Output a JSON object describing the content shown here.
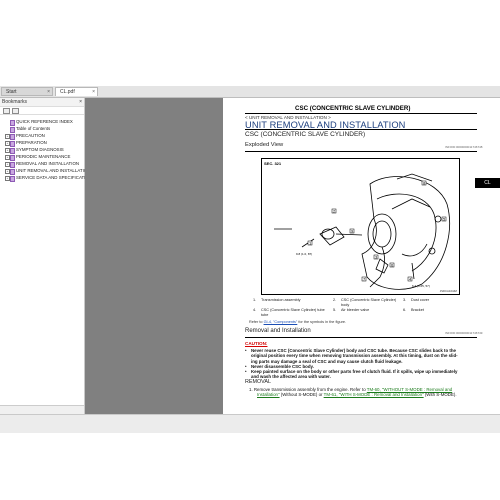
{
  "tabs": [
    {
      "label": "Start",
      "close": "×"
    },
    {
      "label": "CL.pdf",
      "close": "×"
    }
  ],
  "sidebar": {
    "title": "Bookmarks",
    "close": "×",
    "items": [
      {
        "label": "QUICK REFERENCE INDEX",
        "expander": ""
      },
      {
        "label": "Table of Contents",
        "expander": ""
      },
      {
        "label": "PRECAUTION",
        "expander": "+"
      },
      {
        "label": "PREPARATION",
        "expander": "+"
      },
      {
        "label": "SYMPTOM DIAGNOSIS",
        "expander": "+"
      },
      {
        "label": "PERIODIC MAINTENANCE",
        "expander": "+"
      },
      {
        "label": "REMOVAL AND INSTALLATION",
        "expander": "+"
      },
      {
        "label": "UNIT REMOVAL AND INSTALLATIO",
        "expander": "+"
      },
      {
        "label": "SERVICE DATA AND SPECIFICATI",
        "expander": "+"
      }
    ]
  },
  "document": {
    "title": "CSC (CONCENTRIC SLAVE CYLINDER)",
    "breadcrumb": "< UNIT REMOVAL AND INSTALLATION >",
    "section_title": "UNIT REMOVAL AND INSTALLATION",
    "subsection_title": "CSC (CONCENTRIC SLAVE CYLINDER)",
    "exploded_view": "Exploded View",
    "ref_code_1": "INFOID:0000000011746748",
    "side_tab": "CL",
    "figure": {
      "sec_label": "SEC. 321",
      "callouts": [
        "1",
        "2",
        "3",
        "4",
        "5",
        "6",
        "7",
        "8",
        "9"
      ],
      "torque_label": "9.8 (1.0, 87)",
      "torque_label_2": "6.4 (0.65, 57)",
      "code": "JSDCA104ZZ"
    },
    "parts": [
      {
        "num": "1.",
        "name": "Transmission assembly"
      },
      {
        "num": "2.",
        "name": "CSC (Concentric Slave Cylinder)"
      },
      {
        "num": "3.",
        "name": "Dust cover"
      },
      {
        "num": "4.",
        "name": "CSC (Concentric Slave Cylinder) tube"
      },
      {
        "num": "5.",
        "name": "Air bleeder valve"
      },
      {
        "num": "6.",
        "name": "Bracket"
      }
    ],
    "parts_extra": [
      "body",
      "tube"
    ],
    "components_note_prefix": "Refer to ",
    "components_note_link": "GI-4, \"Components\"",
    "components_note_suffix": " for the symbols in the figure.",
    "removal_installation": "Removal and Installation",
    "ref_code_2": "INFOID:0000000011746749",
    "caution_label": "CAUTION:",
    "caution_1a": "Never reuse CSC (Concentric Slave Cylinder) body and CSC tube. Because CSC slides back to the",
    "caution_1b": "original position every time when removing transmission assembly. At this timing, dust on the slid-",
    "caution_1c": "ing parts may damage a seal of CSC and may cause clutch fluid leakage.",
    "caution_2": "Never disassemble CSC body.",
    "caution_3a": "Keep painted surface on the body or other parts free of clutch fluid. If it spills, wipe up immediately",
    "caution_3b": "and wash the affected area with water.",
    "removal": "REMOVAL",
    "step_1_prefix": "1.   Remove transmission assembly from the engine. Refer to ",
    "step_1_link1": "TM-60, \"WITHOUT S-MODE : Removal and",
    "step_1_link1b": "Installation\"",
    "step_1_mid": " (Without S-MODE) or ",
    "step_1_link2": "TM-61, \"WITH S-MODE : Removal and Installation\"",
    "step_1_suffix": " (With S-MODE)."
  }
}
